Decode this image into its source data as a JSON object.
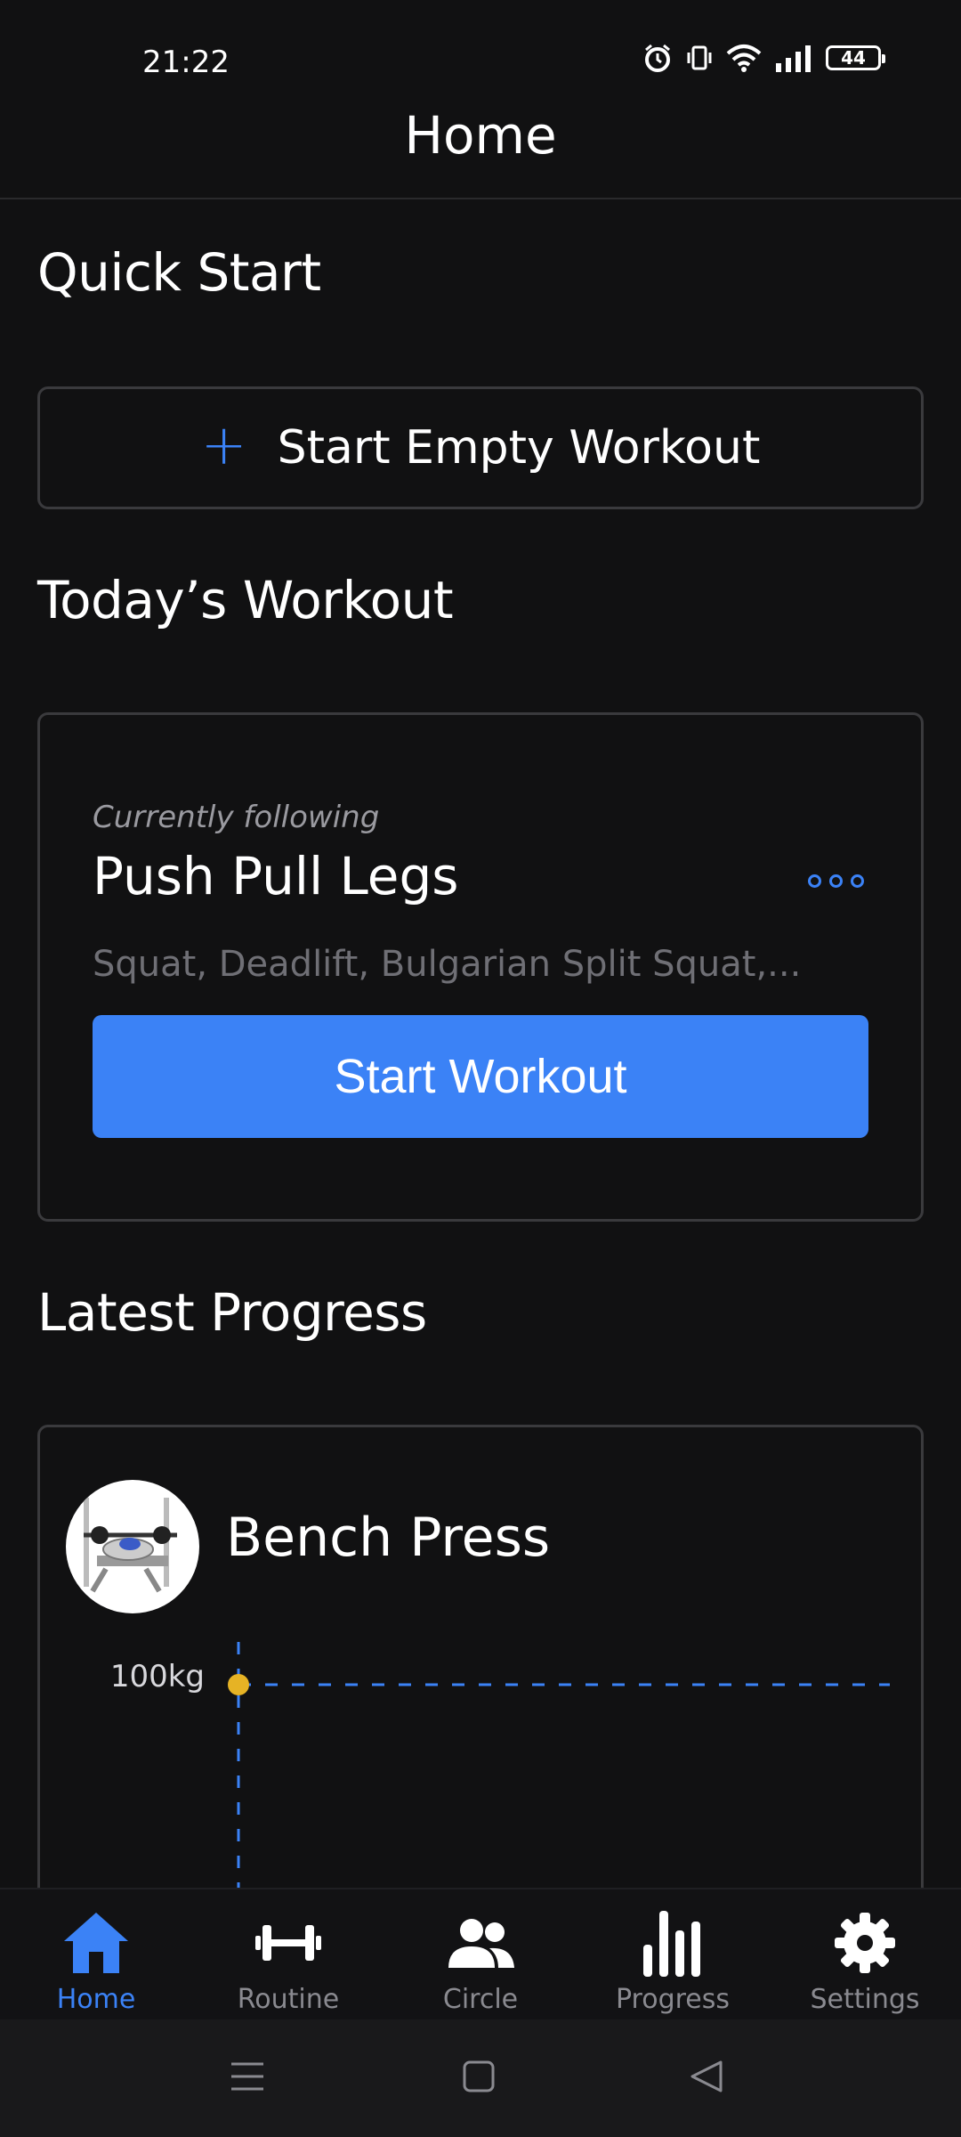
{
  "status_bar": {
    "time": "21:22",
    "battery": "44"
  },
  "header": {
    "title": "Home"
  },
  "quick_start": {
    "title": "Quick Start",
    "empty_workout_label": "Start Empty Workout"
  },
  "todays_workout": {
    "title": "Today’s Workout",
    "following_label": "Currently following",
    "routine_name": "Push Pull Legs",
    "exercises": "Squat, Deadlift, Bulgarian Split Squat,...",
    "start_label": "Start Workout"
  },
  "latest_progress": {
    "title": "Latest Progress",
    "exercise_name": "Bench Press",
    "chart_label": "100kg"
  },
  "chart_data": {
    "type": "line",
    "x": [
      1
    ],
    "series": [
      {
        "values": [
          100
        ]
      }
    ],
    "tick_labels": [
      "100kg"
    ],
    "point_color": "#e6b325",
    "line_color": "#3b82f6"
  },
  "bottom_nav": {
    "items": [
      {
        "label": "Home",
        "icon": "home-icon",
        "active": true
      },
      {
        "label": "Routine",
        "icon": "dumbbell-icon",
        "active": false
      },
      {
        "label": "Circle",
        "icon": "people-icon",
        "active": false
      },
      {
        "label": "Progress",
        "icon": "bar-chart-icon",
        "active": false
      },
      {
        "label": "Settings",
        "icon": "gear-icon",
        "active": false
      }
    ]
  },
  "colors": {
    "accent": "#3b82f6",
    "background": "#111112",
    "card_border": "#3a3a3d"
  }
}
